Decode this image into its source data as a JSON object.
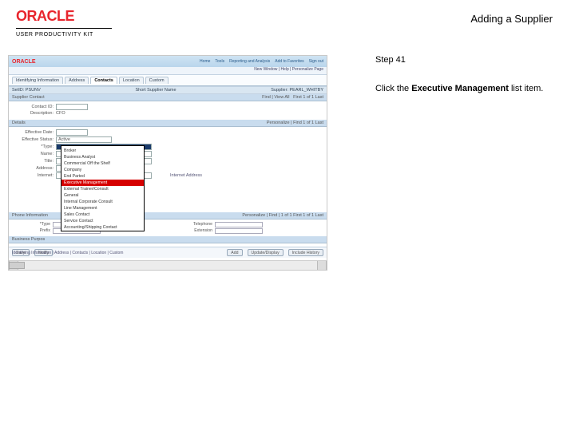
{
  "header": {
    "brand": "ORACLE",
    "brand_sub": "USER PRODUCTIVITY KIT",
    "page_title": "Adding a Supplier"
  },
  "instructions": {
    "step_label": "Step 41",
    "text_pre": "Click the ",
    "text_bold": "Executive Management",
    "text_post": " list item."
  },
  "shot": {
    "oracle": "ORACLE",
    "nav": [
      "Home",
      "Tools",
      "Reporting and Analysis",
      "Add to Favorites",
      "Sign out"
    ],
    "subbar": "New Window | Help | Personalize Page",
    "tabs": [
      "Identifying Information",
      "Address",
      "Contacts",
      "Location",
      "Custom"
    ],
    "region_left": "SetID: PSUNV",
    "region_right": "Short Supplier Name",
    "region_far": "Supplier: PEARL_WHITBY",
    "panel_left": "Supplier Contact",
    "panel_right_1": "Find | View All",
    "panel_right_2": "First  1 of 1  Last",
    "contact_lbl": "Contact ID:",
    "desc_lbl": "Description:",
    "desc_val": "CFO",
    "details_bar": "Details",
    "details_right": "Personalize | Find  1 of 1  Last",
    "eff_date_lbl": "Effective Date:",
    "eff_status_lbl": "Effective Status:",
    "eff_status_val": "Active",
    "type_lbl": "*Type:",
    "type_sel": "",
    "name_lbl": "Name:",
    "title_lbl": "Title:",
    "addr_lbl": "Address:",
    "internet_lbl": "Internet:",
    "dropdown_opts": [
      "",
      "Broker",
      "Business Analyst",
      "Commercial Off the Shelf",
      "Company",
      "End Parted",
      "Executive Management",
      "External Trainer/Consult",
      "General",
      "Internal Corporate Consult",
      "Line Management",
      "Sales Contact",
      "Service Contact",
      "Accounting/Shipping Contact"
    ],
    "dropdown_hl_index": 6,
    "phone_hdr": "Phone Information",
    "phone_right": "Personalize | Find |    1 of 1    First  1 of 1  Last",
    "type2_lbl": "*Type",
    "prefix_lbl": "Prefix",
    "telephone_lbl": "Telephone",
    "ext_lbl": "Extension",
    "bank_hdr": "Business Purpos",
    "btn_save": "Save",
    "btn_notify": "Notify",
    "btn_add": "Add",
    "btn_update": "Update/Display",
    "btn_include": "Include History",
    "crumb": "Identifying Information | Address | Contacts | Location | Custom"
  }
}
